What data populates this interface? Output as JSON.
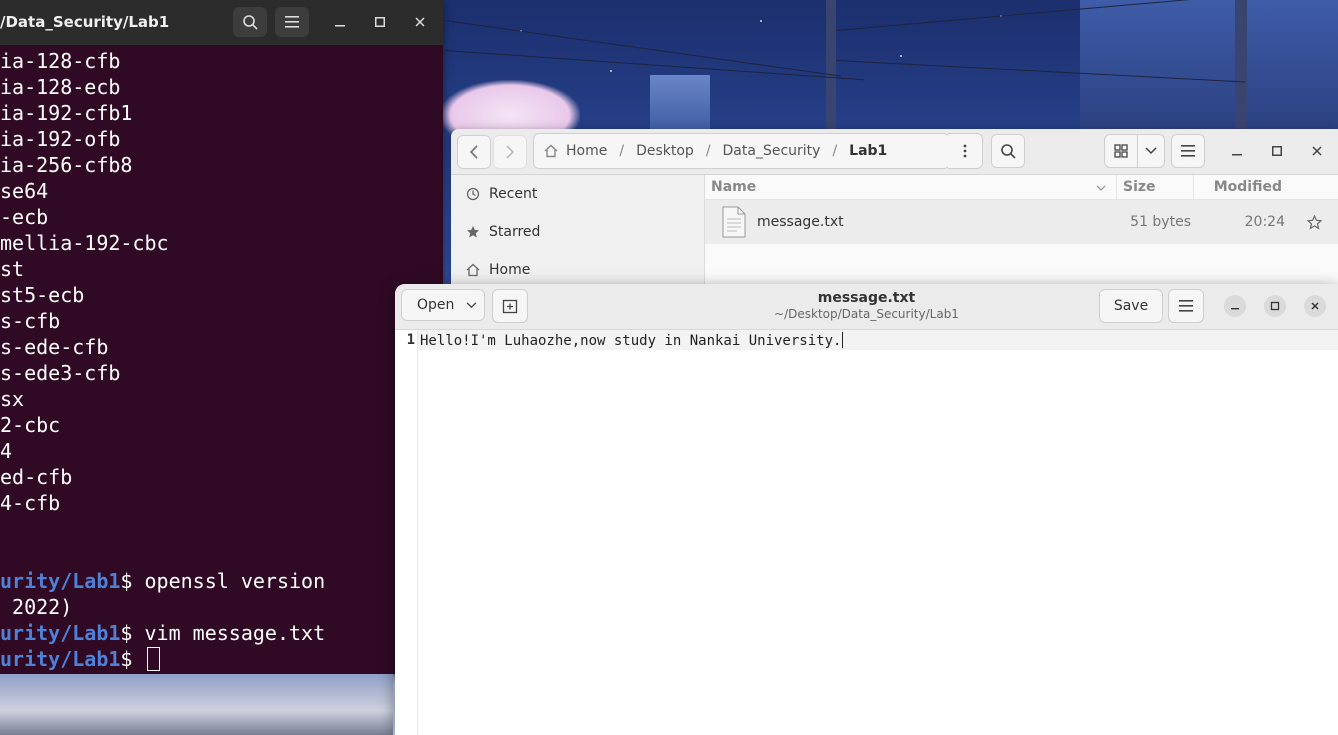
{
  "terminal": {
    "title": "/Data_Security/Lab1",
    "lines": [
      "ia-128-cfb",
      "ia-128-ecb",
      "ia-192-cfb1",
      "ia-192-ofb",
      "ia-256-cfb8",
      "se64",
      "-ecb",
      "mellia-192-cbc",
      "st",
      "st5-ecb",
      "s-cfb",
      "s-ede-cfb",
      "s-ede3-cfb",
      "sx",
      "2-cbc",
      "4",
      "ed-cfb",
      "4-cfb",
      "",
      ""
    ],
    "prompt_prefix": "urity/Lab1",
    "dollar": "$ ",
    "cmd1": "openssl version",
    "output1": " 2022)",
    "cmd2": "vim message.txt",
    "icons": {
      "search": "search-icon",
      "menu": "hamburger-menu-icon",
      "minimize": "minimize-icon",
      "maximize": "maximize-icon",
      "close": "close-icon"
    }
  },
  "files": {
    "breadcrumb": [
      "Home",
      "Desktop",
      "Data_Security",
      "Lab1"
    ],
    "sidebar": [
      {
        "label": "Recent",
        "icon": "clock-icon"
      },
      {
        "label": "Starred",
        "icon": "star-icon"
      },
      {
        "label": "Home",
        "icon": "home-icon"
      }
    ],
    "columns": {
      "name": "Name",
      "size": "Size",
      "modified": "Modified"
    },
    "files": [
      {
        "name": "message.txt",
        "size": "51 bytes",
        "modified": "20:24",
        "icon": "text-file-icon"
      }
    ]
  },
  "editor": {
    "open_label": "Open",
    "save_label": "Save",
    "title": "message.txt",
    "subtitle": "~/Desktop/Data_Security/Lab1",
    "line_number": "1",
    "content": "Hello!I'm Luhaozhe,now study in Nankai University."
  },
  "colors": {
    "terminal_bg": "#300a24",
    "prompt": "#4e82d9",
    "header_bg": "#2c2c2c"
  }
}
